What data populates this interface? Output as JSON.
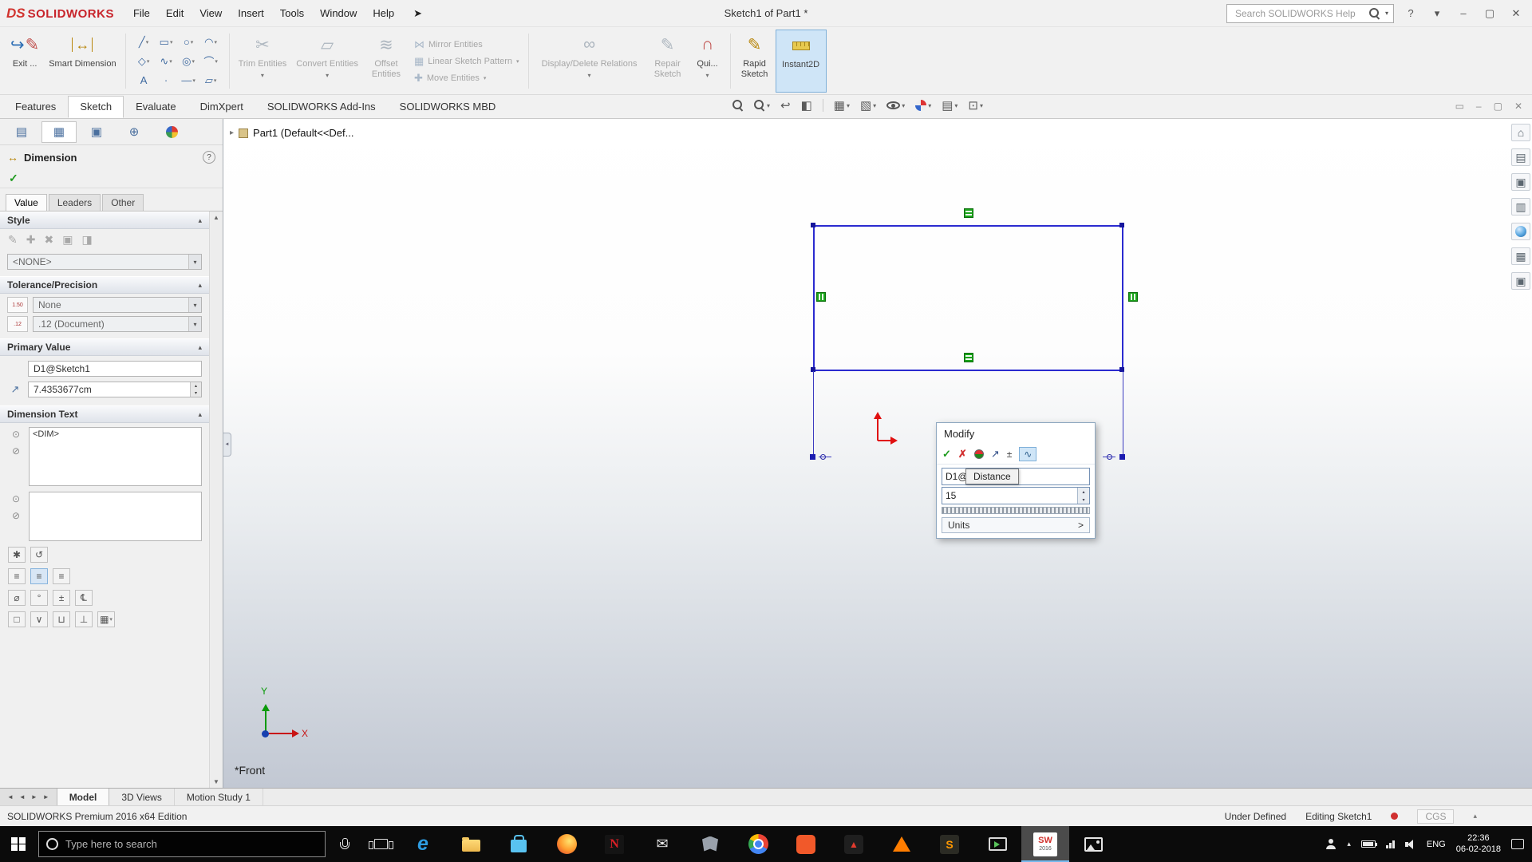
{
  "icons": {
    "caret": "▾",
    "caret_up": "▴",
    "scroll_up": "▲",
    "scroll_down": "▼",
    "left_arrow": "◄",
    "right_arrow": "►",
    "check": "✓",
    "cross": "✗",
    "help": "?",
    "menu_pin": "➤",
    "flyout_arrow": "▸",
    "ne_arrow": "↗",
    "exit_arrow": "↪",
    "pencil": "✎",
    "dim_arrow": "↔",
    "scissors": "✂",
    "convert": "▱",
    "offset": "≋",
    "mirror": "⋈",
    "pattern": "▦",
    "move": "✚",
    "relations": "∞",
    "quick_snap": "∩",
    "line": "╱",
    "rect": "▭",
    "circle": "○",
    "arc": "◠",
    "polygon": "◇",
    "spline": "∿",
    "ellipse": "◎",
    "arc2": "⌒",
    "text_tool": "A",
    "point_tool": "·",
    "centerline": "—",
    "slot": "▱",
    "prev_view": "↩",
    "section": "◧",
    "orientation": "▦",
    "display_style": "▧",
    "scene": "▤",
    "view_settings": "⊡",
    "house": "⌂",
    "library": "▤",
    "palette": "▥",
    "props": "▦",
    "pane": "▣",
    "tree": "▤",
    "propmgr": "▦",
    "config": "▣",
    "dimxpert": "⊕",
    "style1": "✎",
    "style2": "✚",
    "style3": "✖",
    "style4": "▣",
    "style5": "◨",
    "gutter1": "⊙",
    "gutter2": "⊘",
    "justify": "≡",
    "sym_dia": "⌀",
    "sym_deg": "°",
    "sym_pm": "±",
    "sym_cl": "℄",
    "sym_sq": "□",
    "sym_v": "∨",
    "sym_u": "⊔",
    "sym_perp": "⊥",
    "sym_grid": "▦",
    "more1": "✱",
    "more2": "↺",
    "envelope": "✉",
    "tri_up": "▲",
    "win_min": "–",
    "win_restore": "▢",
    "win_close": "✕",
    "doc_pane": "▭"
  },
  "titlebar": {
    "logo_mark": "DS",
    "logo_text": "SOLIDWORKS",
    "menus": [
      "File",
      "Edit",
      "View",
      "Insert",
      "Tools",
      "Window",
      "Help"
    ],
    "title": "Sketch1 of Part1 *",
    "search_placeholder": "Search SOLIDWORKS Help"
  },
  "ribbon": {
    "exit_sketch": "Exit ...",
    "smart_dimension": "Smart Dimension",
    "trim": "Trim Entities",
    "convert": "Convert Entities",
    "offset": "Offset Entities",
    "mirror": "Mirror Entities",
    "linear_pattern": "Linear Sketch Pattern",
    "move": "Move Entities",
    "display_delete": "Display/Delete Relations",
    "repair": "Repair Sketch",
    "quick": "Qui...",
    "rapid": "Rapid Sketch",
    "instant2d": "Instant2D"
  },
  "command_tabs": [
    "Features",
    "Sketch",
    "Evaluate",
    "DimXpert",
    "SOLIDWORKS Add-Ins",
    "SOLIDWORKS MBD"
  ],
  "tree": {
    "root": "Part1  (Default<<Def..."
  },
  "panel": {
    "title": "Dimension",
    "tabs": [
      "Value",
      "Leaders",
      "Other"
    ],
    "style_label": "Style",
    "style_value": "<NONE>",
    "tolerance_label": "Tolerance/Precision",
    "tolerance_value": "None",
    "precision_value": ".12 (Document)",
    "tol_icon": "1.50",
    "prec_icon": ".12",
    "primary_label": "Primary Value",
    "dim_name": "D1@Sketch1",
    "dim_value": "7.4353677cm",
    "dimtext_label": "Dimension Text",
    "dim_token": "<DIM>"
  },
  "modify": {
    "title": "Modify",
    "name": "D1@Sketch1",
    "tooltip": "Distance",
    "value": "15",
    "units": "Units",
    "chevron": ">"
  },
  "viewport": {
    "view_label": "*Front",
    "axis_x": "X",
    "axis_y": "Y"
  },
  "doc_tabs": [
    "Model",
    "3D Views",
    "Motion Study 1"
  ],
  "statusbar": {
    "edition": "SOLIDWORKS Premium 2016 x64 Edition",
    "state": "Under Defined",
    "mode": "Editing Sketch1",
    "units": "CGS"
  },
  "taskbar": {
    "search_placeholder": "Type here to search",
    "lang": "ENG",
    "time": "22:36",
    "date": "06-02-2018",
    "edge": "e",
    "netflix": "N",
    "sublime": "S",
    "sw": "SW",
    "sw_year": "2016"
  }
}
